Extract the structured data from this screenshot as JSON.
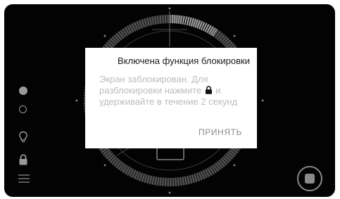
{
  "dialog": {
    "title": "Включена функция блокировки",
    "message_part1": "Экран заблокирован. Для разблокировки нажмите",
    "message_part2": "и удерживайте в течение 2 секунд",
    "accept_label": "ПРИНЯТЬ"
  },
  "colors": {
    "background": "#030303",
    "dialog_bg": "#ffffff",
    "title_text": "#1b1b1b",
    "body_text": "#bdbdbd",
    "icon_gray": "#9a9a9a"
  },
  "icons": {
    "sidebar": [
      "filled-circle-icon",
      "empty-circle-icon",
      "bulb-icon",
      "lock-icon",
      "menu-icon"
    ],
    "stop": "stop-icon",
    "inline": "lock-icon"
  }
}
